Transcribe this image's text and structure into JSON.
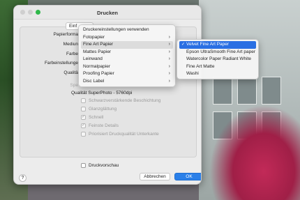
{
  "window": {
    "title": "Drucken"
  },
  "tab_label": "Einf",
  "labels": {
    "paper_format": "Papierforma",
    "medium": "Mediun",
    "color": "Farbe",
    "color_settings": "Farbeinstellunge",
    "quality": "Qualitä",
    "spe": "Spe",
    "quality_value": "Qualität  SuperPhoto - 5760dpi"
  },
  "checkboxes": [
    {
      "label": "Schwarzverstärkende Beschichtung",
      "checked": false
    },
    {
      "label": "Glanzglättung",
      "checked": false
    },
    {
      "label": "Schnell",
      "checked": true
    },
    {
      "label": "Feinste Details",
      "checked": true
    },
    {
      "label": "Priorisiert Druckqualität Unterkante",
      "checked": false
    }
  ],
  "preview_label": "Druckvorschau",
  "buttons": {
    "help": "?",
    "cancel": "Abbrechen",
    "ok": "OK"
  },
  "media_menu": [
    {
      "label": "Druckereinstellungen verwenden",
      "submenu": false
    },
    {
      "label": "Fotopapier",
      "submenu": true
    },
    {
      "label": "Fine Art Papier",
      "submenu": true,
      "highlighted": true
    },
    {
      "label": "Mattes Papier",
      "submenu": true
    },
    {
      "label": "Leinwand",
      "submenu": true
    },
    {
      "label": "Normalpapier",
      "submenu": true
    },
    {
      "label": "Proofing Papier",
      "submenu": true
    },
    {
      "label": "Disc Label",
      "submenu": true
    }
  ],
  "fine_art_menu": [
    {
      "label": "Velvet Fine Art Paper",
      "selected": true
    },
    {
      "label": "Epson UltraSmooth Fine Art paper",
      "selected": false
    },
    {
      "label": "Watercolor Paper Radiant White",
      "selected": false
    },
    {
      "label": "Fine Art Matte",
      "selected": false
    },
    {
      "label": "Washi",
      "selected": false
    }
  ],
  "glyphs": {
    "chevron": "›",
    "check": "✓"
  },
  "colors": {
    "accent": "#2a6fe3",
    "ok_button": "#2a7fe8",
    "window_green": "#2fb84a"
  }
}
